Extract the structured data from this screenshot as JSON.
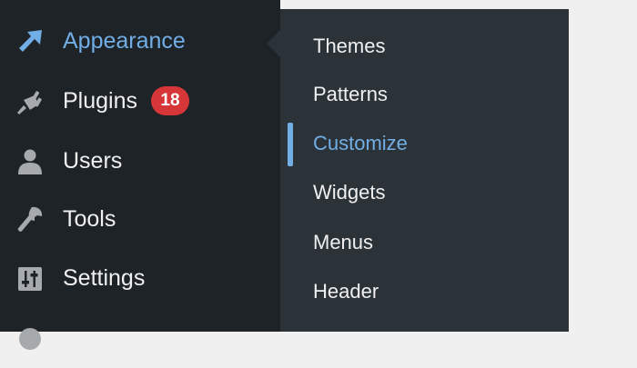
{
  "sidebar": {
    "items": [
      {
        "label": "Appearance",
        "icon": "paintbrush-icon",
        "active": true
      },
      {
        "label": "Plugins",
        "icon": "plugin-icon",
        "badge": "18"
      },
      {
        "label": "Users",
        "icon": "users-icon"
      },
      {
        "label": "Tools",
        "icon": "wrench-icon"
      },
      {
        "label": "Settings",
        "icon": "settings-sliders-icon"
      }
    ]
  },
  "submenu": {
    "items": [
      {
        "label": "Themes"
      },
      {
        "label": "Patterns"
      },
      {
        "label": "Customize",
        "current": true
      },
      {
        "label": "Widgets"
      },
      {
        "label": "Menus"
      },
      {
        "label": "Header"
      }
    ]
  },
  "colors": {
    "sidebar_bg": "#1d2327",
    "submenu_bg": "#2c3338",
    "text": "#f0f0f1",
    "accent": "#72aee6",
    "badge": "#d63638",
    "icon": "#a7aaad",
    "page_bg": "#f0f0f1"
  }
}
